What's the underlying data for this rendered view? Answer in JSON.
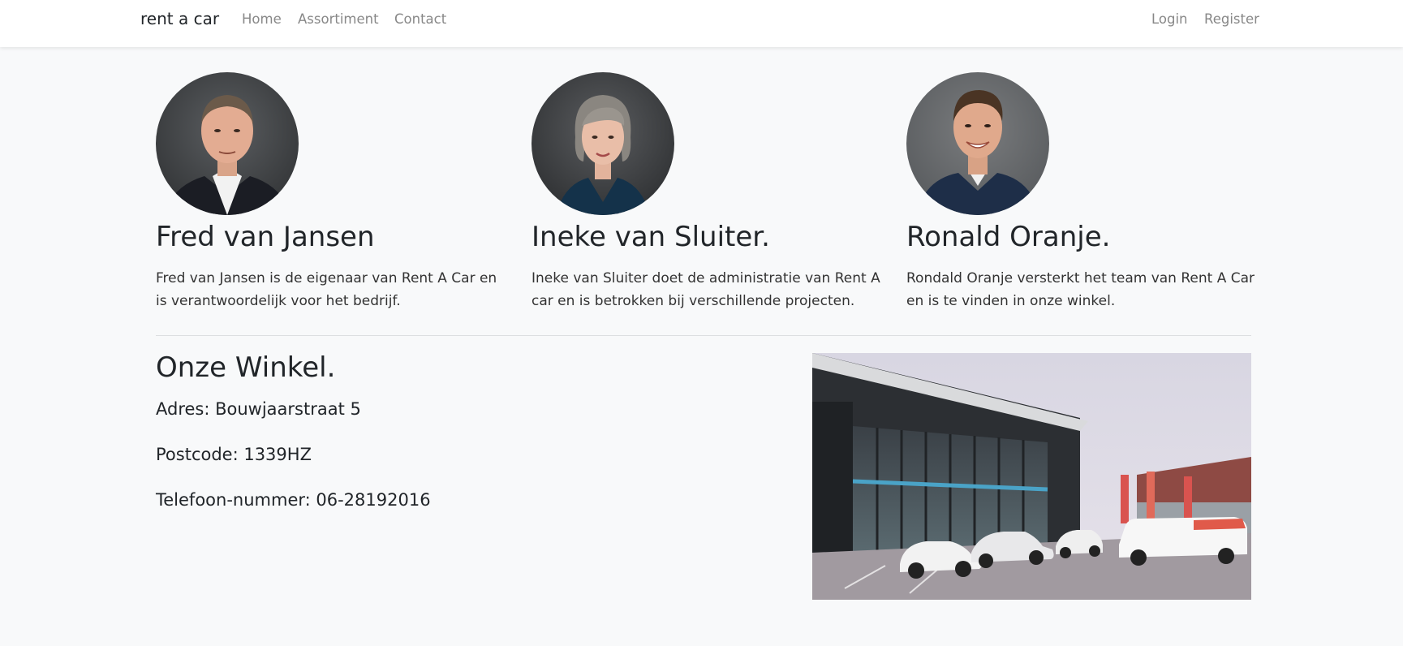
{
  "nav": {
    "brand": "rent a car",
    "links": [
      "Home",
      "Assortiment",
      "Contact"
    ],
    "auth": [
      "Login",
      "Register"
    ]
  },
  "team": [
    {
      "name": "Fred van Jansen",
      "description": "Fred van Jansen is de eigenaar van Rent A Car en is verantwoordelijk voor het bedrijf."
    },
    {
      "name": "Ineke van Sluiter.",
      "description": "Ineke van Sluiter doet de administratie van Rent A car en is betrokken bij verschillende projecten."
    },
    {
      "name": "Ronald Oranje.",
      "description": "Rondald Oranje versterkt het team van Rent A Car en is te vinden in onze winkel."
    }
  ],
  "shop": {
    "title": "Onze Winkel.",
    "address": "Adres: Bouwjaarstraat 5",
    "postcode": "Postcode: 1339HZ",
    "phone": "Telefoon-nummer: 06-28192016"
  },
  "colors": {
    "background": "#f8f9fa",
    "navbar": "#ffffff",
    "nav_link": "#888888",
    "text": "#212529"
  }
}
